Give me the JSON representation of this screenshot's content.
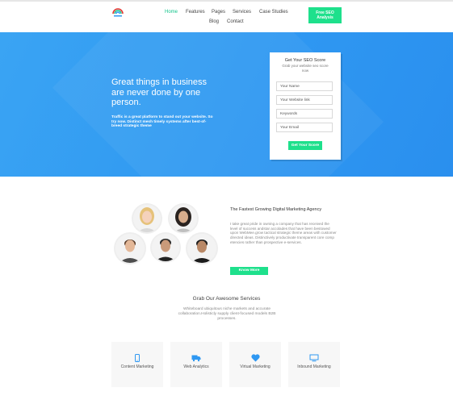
{
  "nav": {
    "items": [
      "Home",
      "Features",
      "Pages",
      "Services",
      "Case Studies",
      "Blog",
      "Contact"
    ],
    "cta": "Free SEO Analysis"
  },
  "hero": {
    "headline": "Great things in business are never done by one person.",
    "text": "Traffic is a great platform to stand out your website. So try now. Distinct mesh timely systems after best-of-breed strategic theme"
  },
  "form": {
    "title": "Get Your SEO Score",
    "subtitle": "Grab your website seo score now",
    "placeholders": [
      "Your Name",
      "Your Website link",
      "Keywords",
      "Your Email"
    ],
    "button": "Get Your Score"
  },
  "about": {
    "title": "The Fastest Growing Digital Marketing Agency",
    "text": "I take great pride in owning a company that has received the level of success andstar accolades that have been bestowed upon WebMee.grow tactical strategic theme areas with customer directed ideas. Distinctively productivate transparent core comp etencies rather than prospective e-services.",
    "button": "Know More"
  },
  "services": {
    "title": "Grab Our Awesome Services",
    "subtitle": "Whiteboard ubiquitous niche markets and accurate collaboration.Holisticly supply client-focused models B2B processes.",
    "cards": [
      {
        "label": "Content Marketing",
        "icon": "mobile-icon"
      },
      {
        "label": "Web Analytics",
        "icon": "truck-icon"
      },
      {
        "label": "Virtual Marketing",
        "icon": "heart-icon"
      },
      {
        "label": "Inbound Marketing",
        "icon": "monitor-icon"
      }
    ]
  },
  "colors": {
    "accent": "#1ee08c",
    "hero_blue": "#2f98f2",
    "nav_active": "#13c48b"
  }
}
